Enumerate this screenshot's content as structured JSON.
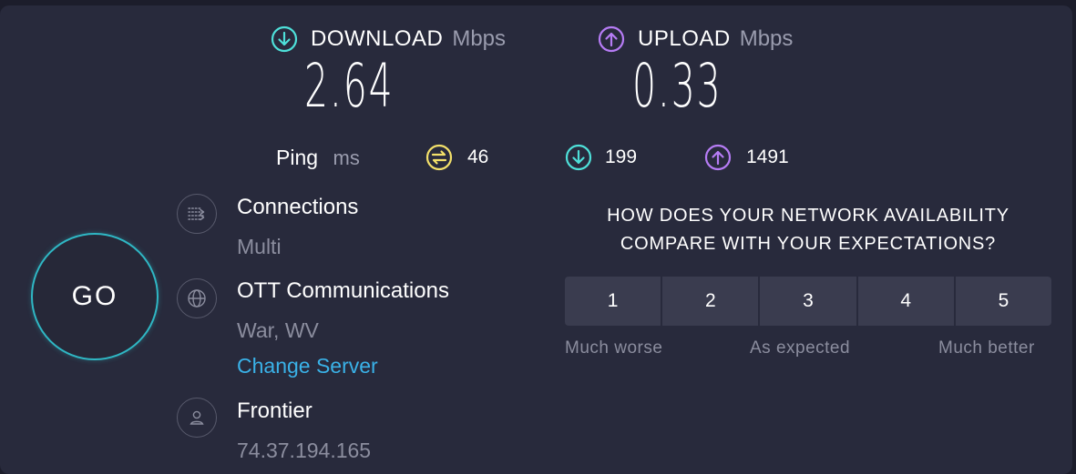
{
  "download": {
    "title": "DOWNLOAD",
    "unit": "Mbps",
    "value": "2.64",
    "icon": "download-arrow-icon",
    "color": "#4ee0d9"
  },
  "upload": {
    "title": "UPLOAD",
    "unit": "Mbps",
    "value": "0.33",
    "icon": "upload-arrow-icon",
    "color": "#b67cf5"
  },
  "ping": {
    "label": "Ping",
    "unit": "ms",
    "idle": "46",
    "download": "199",
    "upload": "1491",
    "idle_color": "#f3e06a"
  },
  "go_button": {
    "label": "GO",
    "color": "#2fb7c4"
  },
  "connections": {
    "title": "Connections",
    "value": "Multi",
    "icon": "connections-icon"
  },
  "server": {
    "name": "OTT Communications",
    "location": "War, WV",
    "change_label": "Change Server",
    "icon": "globe-icon",
    "link_color": "#3ab2e8"
  },
  "provider": {
    "name": "Frontier",
    "ip": "74.37.194.165",
    "icon": "user-icon"
  },
  "survey": {
    "question_line1": "HOW DOES YOUR NETWORK AVAILABILITY",
    "question_line2": "COMPARE WITH YOUR EXPECTATIONS?",
    "options": [
      "1",
      "2",
      "3",
      "4",
      "5"
    ],
    "label_low": "Much worse",
    "label_mid": "As expected",
    "label_high": "Much better"
  }
}
